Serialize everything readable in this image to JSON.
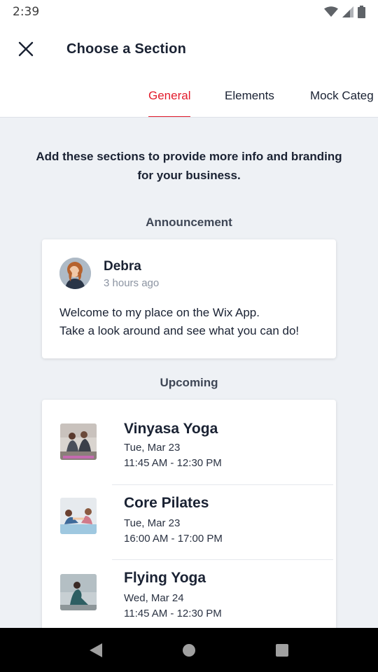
{
  "status_bar": {
    "time": "2:39",
    "icons": [
      "wifi-icon",
      "signal-icon",
      "battery-icon"
    ]
  },
  "header": {
    "title": "Choose a Section",
    "close_icon": "close-icon"
  },
  "tabs": [
    {
      "label": "General",
      "active": true
    },
    {
      "label": "Elements",
      "active": false
    },
    {
      "label": "Mock Categ",
      "active": false
    }
  ],
  "intro": "Add these sections to provide more info and branding for your business.",
  "announcement": {
    "section_label": "Announcement",
    "author": "Debra",
    "time": "3 hours ago",
    "body_line1": "Welcome to my place on the Wix App.",
    "body_line2": "Take a look around and see what you can do!"
  },
  "upcoming": {
    "section_label": "Upcoming",
    "events": [
      {
        "title": "Vinyasa Yoga",
        "date": "Tue, Mar 23",
        "time": "11:45 AM - 12:30 PM"
      },
      {
        "title": "Core Pilates",
        "date": "Tue, Mar 23",
        "time": "16:00 AM - 17:00 PM"
      },
      {
        "title": "Flying Yoga",
        "date": "Wed, Mar 24",
        "time": "11:45 AM - 12:30 PM"
      }
    ]
  },
  "nav_bar": {
    "buttons": [
      "back-icon",
      "home-icon",
      "recents-icon"
    ]
  },
  "colors": {
    "accent": "#e21b2b",
    "background": "#eef1f5",
    "text": "#1a2233"
  }
}
